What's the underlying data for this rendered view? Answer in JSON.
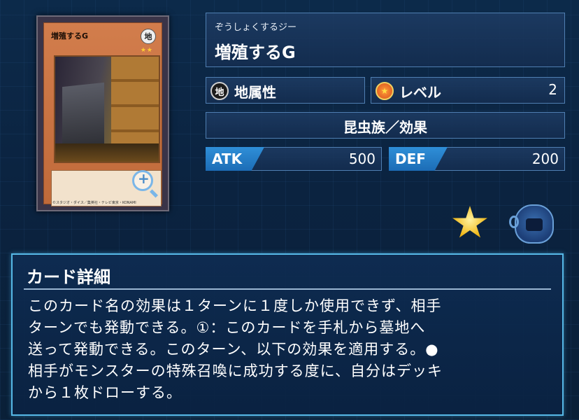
{
  "card": {
    "thumb_name": "増殖するG",
    "thumb_attribute": "地",
    "thumb_stars": "★★",
    "thumb_copyright": "©スタジオ・ダイス／集英社・テレビ東京・KONAMI"
  },
  "header": {
    "ruby": "ぞうしょくするジー",
    "name": "増殖するG"
  },
  "attribute": {
    "icon_char": "地",
    "label": "地属性",
    "icon": "earth-attribute-icon"
  },
  "level": {
    "label": "レベル",
    "value": "2",
    "icon_char": "★",
    "icon": "level-star-icon"
  },
  "type_line": "昆虫族／効果",
  "stats": {
    "atk_label": "ATK",
    "atk_value": "500",
    "def_label": "DEF",
    "def_value": "200"
  },
  "detail": {
    "title": "カード詳細",
    "body": "このカード名の効果は１ターンに１度しか使用できず、相手\nターンでも発動できる。①：このカードを手札から墓地へ\n送って発動できる。このターン、以下の効果を適用する。●\n相手がモンスターの特殊召喚に成功する度に、自分はデッキ\nから１枚ドローする。"
  },
  "colors": {
    "accent": "#2f8fd8",
    "panel_border": "#4f7fb2",
    "detail_border": "#56b8e6"
  }
}
